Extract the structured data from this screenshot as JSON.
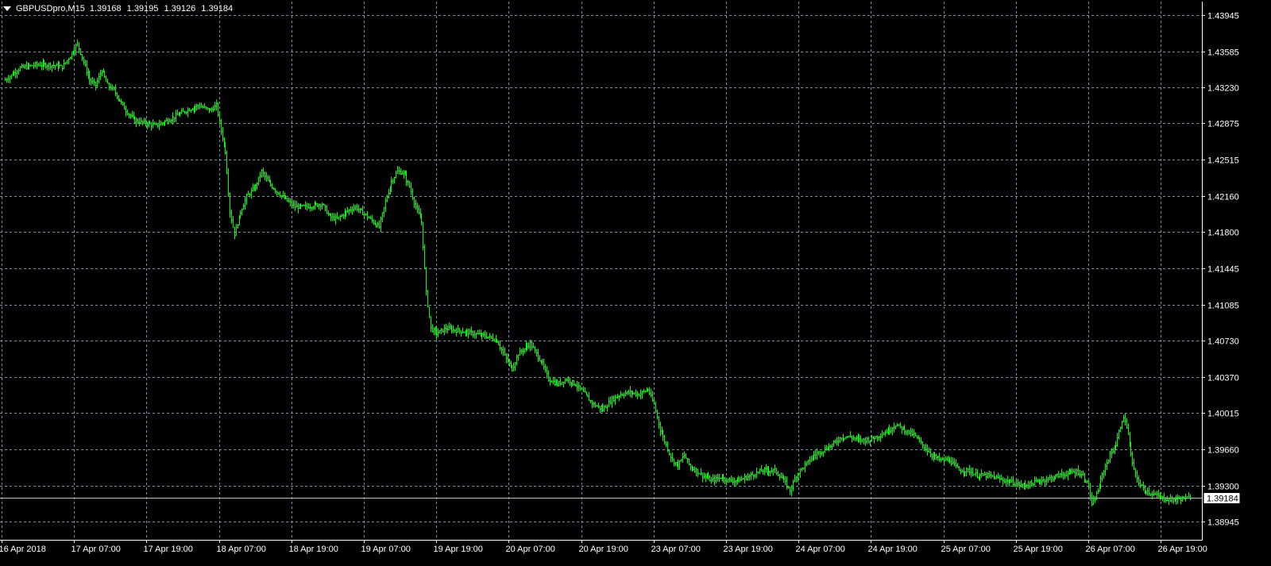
{
  "header": {
    "symbol_timeframe": "GBPUSDpro,M15",
    "open": "1.39168",
    "high": "1.39195",
    "low": "1.39126",
    "close": "1.39184"
  },
  "colors": {
    "background": "#000000",
    "grid": "#7f8ca8",
    "bars": "#00ff00",
    "axis_text": "#ffffff",
    "bid_line": "#c0c0c0"
  },
  "icons": {
    "menu": "triangle-down-icon"
  },
  "current_price_label": "1.39184",
  "chart_data": {
    "type": "line",
    "ohlc_style": "bars",
    "grid": true,
    "price_axis_side": "right",
    "ylim": [
      1.38765,
      1.44075
    ],
    "y_ticks": [
      "1.43945",
      "1.43585",
      "1.43230",
      "1.42875",
      "1.42515",
      "1.42160",
      "1.41800",
      "1.41445",
      "1.41085",
      "1.40730",
      "1.40370",
      "1.40015",
      "1.39660",
      "1.39300",
      "1.38945"
    ],
    "y_tick_values": [
      1.43945,
      1.43585,
      1.4323,
      1.42875,
      1.42515,
      1.4216,
      1.418,
      1.41445,
      1.41085,
      1.4073,
      1.4037,
      1.40015,
      1.3966,
      1.393,
      1.38945
    ],
    "x_tick_labels": [
      "16 Apr 2018",
      "17 Apr 07:00",
      "17 Apr 19:00",
      "18 Apr 07:00",
      "18 Apr 19:00",
      "19 Apr 07:00",
      "19 Apr 19:00",
      "20 Apr 07:00",
      "20 Apr 19:00",
      "23 Apr 07:00",
      "23 Apr 19:00",
      "24 Apr 07:00",
      "24 Apr 19:00",
      "25 Apr 07:00",
      "25 Apr 19:00",
      "26 Apr 07:00",
      "26 Apr 19:00"
    ],
    "x_tick_bars": [
      0,
      48,
      96,
      144,
      192,
      240,
      288,
      336,
      384,
      432,
      480,
      528,
      576,
      624,
      672,
      720,
      768
    ],
    "bid_price": 1.39184,
    "series": [
      {
        "values": [
          [
            0,
            1.433
          ],
          [
            10,
            1.4342
          ],
          [
            20,
            1.4345
          ],
          [
            30,
            1.4345
          ],
          [
            38,
            1.4343
          ],
          [
            44,
            1.4356
          ],
          [
            48,
            1.4366
          ],
          [
            52,
            1.4348
          ],
          [
            56,
            1.433
          ],
          [
            60,
            1.4325
          ],
          [
            64,
            1.434
          ],
          [
            68,
            1.4325
          ],
          [
            72,
            1.432
          ],
          [
            80,
            1.43
          ],
          [
            86,
            1.429
          ],
          [
            92,
            1.4288
          ],
          [
            100,
            1.4285
          ],
          [
            110,
            1.4292
          ],
          [
            120,
            1.43
          ],
          [
            128,
            1.4305
          ],
          [
            136,
            1.43
          ],
          [
            140,
            1.4305
          ],
          [
            143,
            1.428
          ],
          [
            146,
            1.426
          ],
          [
            149,
            1.42
          ],
          [
            152,
            1.4178
          ],
          [
            156,
            1.42
          ],
          [
            160,
            1.4215
          ],
          [
            166,
            1.4225
          ],
          [
            170,
            1.424
          ],
          [
            174,
            1.423
          ],
          [
            180,
            1.422
          ],
          [
            186,
            1.4212
          ],
          [
            192,
            1.4205
          ],
          [
            200,
            1.4205
          ],
          [
            210,
            1.4208
          ],
          [
            215,
            1.4195
          ],
          [
            220,
            1.4193
          ],
          [
            226,
            1.42
          ],
          [
            232,
            1.4205
          ],
          [
            238,
            1.4198
          ],
          [
            244,
            1.419
          ],
          [
            248,
            1.4185
          ],
          [
            252,
            1.421
          ],
          [
            256,
            1.423
          ],
          [
            260,
            1.424
          ],
          [
            264,
            1.4238
          ],
          [
            268,
            1.4225
          ],
          [
            272,
            1.4205
          ],
          [
            276,
            1.419
          ],
          [
            279,
            1.412
          ],
          [
            282,
            1.4085
          ],
          [
            286,
            1.408
          ],
          [
            292,
            1.4085
          ],
          [
            300,
            1.4083
          ],
          [
            310,
            1.408
          ],
          [
            320,
            1.4077
          ],
          [
            326,
            1.4073
          ],
          [
            332,
            1.4055
          ],
          [
            336,
            1.4045
          ],
          [
            340,
            1.406
          ],
          [
            344,
            1.4065
          ],
          [
            348,
            1.407
          ],
          [
            352,
            1.406
          ],
          [
            356,
            1.405
          ],
          [
            360,
            1.4035
          ],
          [
            366,
            1.403
          ],
          [
            372,
            1.4035
          ],
          [
            378,
            1.403
          ],
          [
            384,
            1.402
          ],
          [
            390,
            1.401
          ],
          [
            396,
            1.4005
          ],
          [
            402,
            1.4015
          ],
          [
            408,
            1.402
          ],
          [
            414,
            1.4022
          ],
          [
            420,
            1.402
          ],
          [
            426,
            1.4025
          ],
          [
            430,
            1.401
          ],
          [
            434,
            1.3985
          ],
          [
            438,
            1.397
          ],
          [
            442,
            1.3955
          ],
          [
            446,
            1.395
          ],
          [
            450,
            1.396
          ],
          [
            454,
            1.3948
          ],
          [
            458,
            1.3945
          ],
          [
            462,
            1.394
          ],
          [
            468,
            1.3935
          ],
          [
            474,
            1.3938
          ],
          [
            480,
            1.3935
          ],
          [
            486,
            1.3935
          ],
          [
            494,
            1.394
          ],
          [
            502,
            1.3945
          ],
          [
            510,
            1.3945
          ],
          [
            516,
            1.3935
          ],
          [
            520,
            1.3925
          ],
          [
            524,
            1.394
          ],
          [
            530,
            1.395
          ],
          [
            536,
            1.396
          ],
          [
            542,
            1.3965
          ],
          [
            548,
            1.397
          ],
          [
            554,
            1.3978
          ],
          [
            560,
            1.3978
          ],
          [
            566,
            1.3975
          ],
          [
            572,
            1.3975
          ],
          [
            580,
            1.398
          ],
          [
            586,
            1.3985
          ],
          [
            590,
            1.399
          ],
          [
            596,
            1.3985
          ],
          [
            602,
            1.398
          ],
          [
            608,
            1.397
          ],
          [
            614,
            1.396
          ],
          [
            620,
            1.3955
          ],
          [
            626,
            1.3955
          ],
          [
            632,
            1.3945
          ],
          [
            638,
            1.3945
          ],
          [
            644,
            1.394
          ],
          [
            650,
            1.394
          ],
          [
            656,
            1.3938
          ],
          [
            662,
            1.3935
          ],
          [
            668,
            1.3933
          ],
          [
            674,
            1.393
          ],
          [
            680,
            1.3932
          ],
          [
            686,
            1.3935
          ],
          [
            692,
            1.3937
          ],
          [
            698,
            1.394
          ],
          [
            704,
            1.3942
          ],
          [
            710,
            1.3944
          ],
          [
            714,
            1.394
          ],
          [
            718,
            1.393
          ],
          [
            720,
            1.391
          ],
          [
            724,
            1.3925
          ],
          [
            728,
            1.3945
          ],
          [
            732,
            1.396
          ],
          [
            736,
            1.397
          ],
          [
            740,
            1.3995
          ],
          [
            742,
            1.3995
          ],
          [
            744,
            1.398
          ],
          [
            746,
            1.396
          ],
          [
            748,
            1.3945
          ],
          [
            752,
            1.393
          ],
          [
            756,
            1.3925
          ],
          [
            760,
            1.3922
          ],
          [
            766,
            1.3918
          ],
          [
            772,
            1.3916
          ],
          [
            778,
            1.3917
          ],
          [
            785,
            1.3918
          ]
        ]
      }
    ]
  }
}
